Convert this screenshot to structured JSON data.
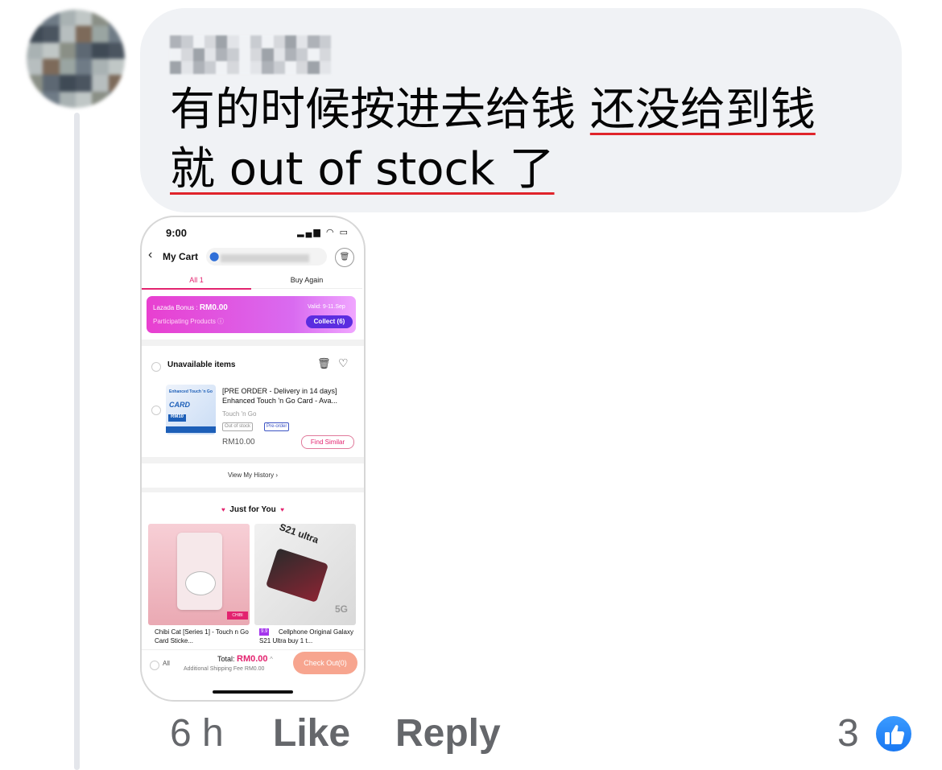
{
  "comment": {
    "text_line1_plain": "有的时候按进去给钱 ",
    "text_line1_underlined": "还没给到钱",
    "text_line2_underlined": "就 out of stock 了"
  },
  "screenshot": {
    "status_time": "9:00",
    "status_icons": "▂▄▆ ◠ ▭",
    "header_title": "My Cart",
    "tabs": [
      "All 1",
      "Buy Again"
    ],
    "bonus": {
      "label": "Lazada Bonus : ",
      "amount": "RM0.00",
      "participating": "Participating Products ⓘ",
      "valid": "Valid: 9-11.Sep",
      "collect": "Collect (6)"
    },
    "unavailable_title": "Unavailable items",
    "item": {
      "name": "[PRE ORDER - Delivery in 14 days] Enhanced Touch 'n Go Card - Ava...",
      "brand": "Touch 'n Go",
      "tag_out": "Out of stock",
      "tag_pre": "Pre-order",
      "price": "RM10.00",
      "find_similar": "Find Similar",
      "card_text_small": "Enhanced Touch 'n Go",
      "card_text_big": "CARD",
      "card_rm": "RM10"
    },
    "view_history": "View My History  ›",
    "just_for_you": "Just for You",
    "tiles": [
      {
        "name": "Chibi Cat [Series 1] - Touch n Go Card Sticke...",
        "badge": "CHIBI"
      },
      {
        "tag": "9.9",
        "name": "Cellphone Original Galaxy S21 Ultra buy 1 t...",
        "model_text": "S21 ultra",
        "badge_5g": "5G"
      }
    ],
    "bottom": {
      "all": "All",
      "total_label": "Total: ",
      "total_value": "RM0.00",
      "shipping": "Additional Shipping Fee RM0.00",
      "checkout": "Check Out(0)"
    }
  },
  "actions": {
    "time": "6 h",
    "like": "Like",
    "reply": "Reply",
    "reaction_count": "3"
  }
}
